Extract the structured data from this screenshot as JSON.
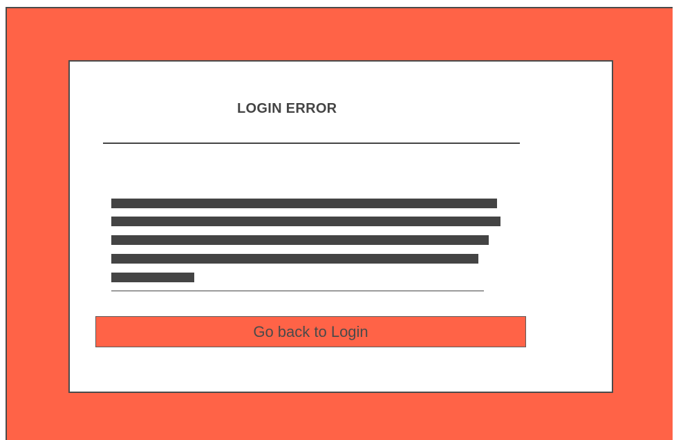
{
  "dialog": {
    "title": "LOGIN ERROR",
    "message_placeholder_lines": 5,
    "back_button_label": "Go back to Login"
  },
  "colors": {
    "accent": "#FF6347",
    "text": "#444444",
    "border": "#4a4a4a",
    "card_background": "#ffffff"
  }
}
